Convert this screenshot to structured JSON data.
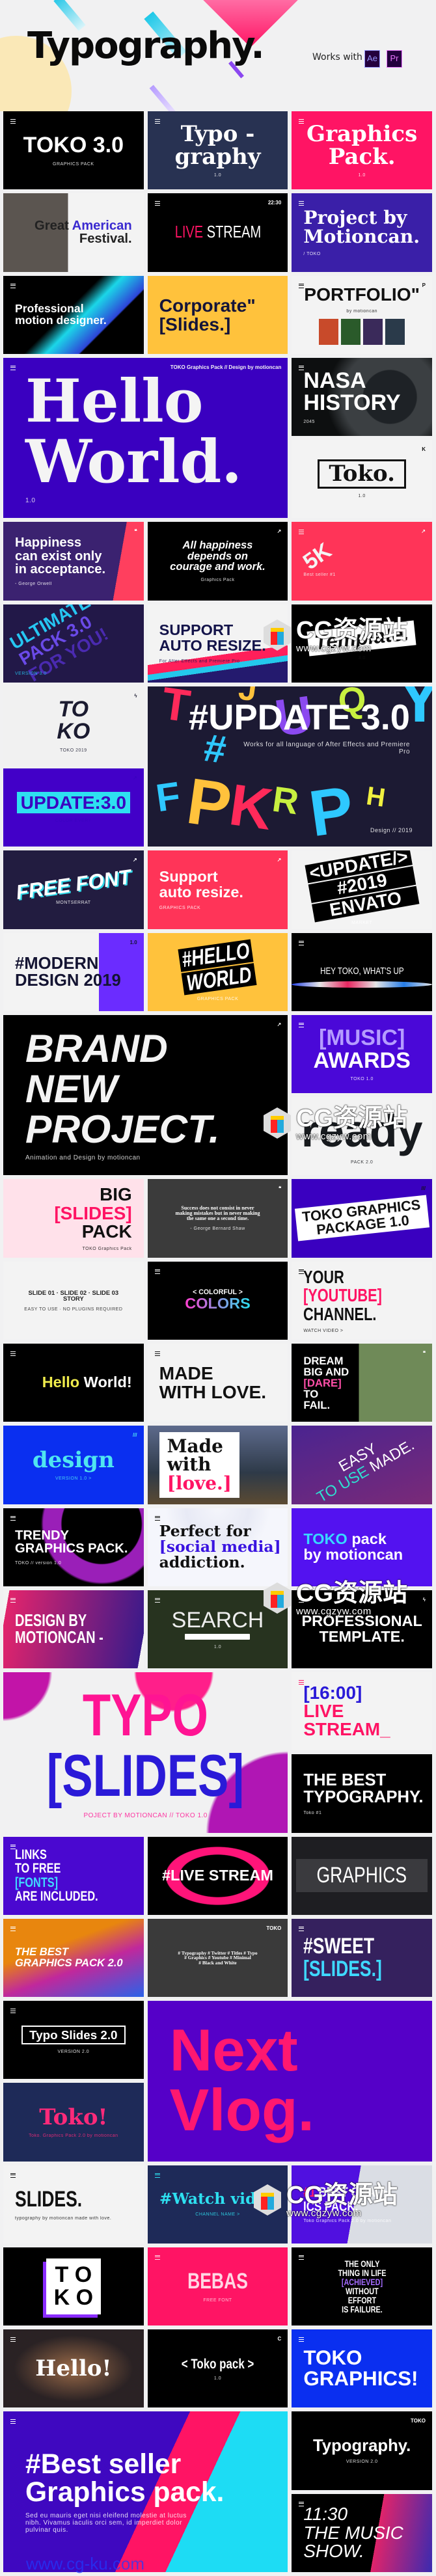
{
  "header": {
    "title": "Typography.",
    "works_with": "Works with",
    "badges": [
      {
        "label": "Ae",
        "color": "#9999ff"
      },
      {
        "label": "Pr",
        "color": "#ea77ff"
      }
    ]
  },
  "watermark": {
    "cn": "CG资源站",
    "url": "www.cgzyw.com",
    "alt_url": "www.cg-ku.com"
  },
  "colors": {
    "page_bg": "#f1f1f2",
    "pink": "#ff1464",
    "blue_violet": "#3a00c0",
    "cyan": "#25d8f0",
    "yellow": "#ffc23c"
  },
  "tiles": [
    {
      "n": "toko-3",
      "bg": "#000",
      "fg": "#fff",
      "a": "c",
      "lines": [
        "TOKO 3.0"
      ],
      "sub": "GRAPHICS PACK",
      "menu": true
    },
    {
      "n": "typography-1",
      "bg": "#283252",
      "fg": "#fff",
      "a": "c",
      "f": "slab",
      "lines": [
        "Typo -",
        "graphy"
      ],
      "sub": "1.0",
      "menu": true
    },
    {
      "n": "graphics-pack",
      "bg": "#ff1464",
      "fg": "#fff",
      "a": "c",
      "f": "slab",
      "lines": [
        "Graphics",
        "Pack."
      ],
      "sub": "1.0",
      "menu": true
    },
    {
      "n": "great-american-festival",
      "bg": "linear-gradient(90deg,#5b5550 0 46%,#f3f3f3 46%)",
      "fg": "#222",
      "a": "r",
      "lines": [
        "Great [American]",
        "Festival."
      ],
      "ac": "#3a2ad0",
      "menu": false
    },
    {
      "n": "live-stream-1",
      "bg": "#000",
      "fg": "#fff",
      "a": "c",
      "f": "cond light",
      "lines": [
        "[LIVE] STREAM"
      ],
      "ac": "#ff1464",
      "corner": "22:30",
      "menu": true
    },
    {
      "n": "project-by-motioncan",
      "bg": "#3a1fa8",
      "fg": "#fff",
      "a": "l",
      "f": "slab",
      "lines": [
        "Project by",
        "Motioncan."
      ],
      "sub": "/ TOKO",
      "menu": true,
      "deco": "blobs"
    },
    {
      "n": "professional-motion-designer",
      "bg": "linear-gradient(135deg,#000 45%,#1bd6e8 55%,#2d45d8 70%,#000 71%)",
      "fg": "#fff",
      "a": "l",
      "lines": [
        "Professional",
        "motion designer."
      ],
      "menu": true
    },
    {
      "n": "corporate-slides",
      "bg": "#ffc23c",
      "fg": "#14143a",
      "a": "l",
      "lines": [
        "Corporate\"",
        "[Slides.]"
      ],
      "ac": "#14143a",
      "menu": false
    },
    {
      "n": "portfolio",
      "bg": "#f3f3f3",
      "fg": "#111",
      "a": "c",
      "lines": [
        "PORTFOLIO\""
      ],
      "sub": "by motioncan",
      "corner": "P",
      "menu": true,
      "deco": "photos"
    },
    {
      "n": "hello-world-big",
      "bg": "#3a00c0",
      "fg": "#f4f4f4",
      "a": "l",
      "f": "slab",
      "big": true,
      "lines": [
        "Hello",
        "World."
      ],
      "sub": "1.0",
      "corner": "TOKO Graphics Pack // Design by motioncan",
      "menu": true
    },
    {
      "n": "nasa-history",
      "bg": "radial-gradient(circle at 70% 50%,#1e2226 0 25%,#3b3f42 26% 45%,#0d0f10 60%)",
      "fg": "#fff",
      "a": "l",
      "lines": [
        "NASA",
        "HISTORY"
      ],
      "sub": "2045",
      "menu": true
    },
    {
      "n": "toko-boxed",
      "bg": "#f3f3f3",
      "fg": "#111",
      "a": "c",
      "f": "slab",
      "lines": [
        "Toko."
      ],
      "sub": "1.0",
      "corner": "K",
      "boxed": true
    },
    {
      "n": "happiness-quote",
      "bg": "linear-gradient(100deg,#3b2270 80%,#ff3f5e 80%)",
      "fg": "#fff",
      "a": "l",
      "lines": [
        "Happiness",
        "can exist only",
        "in acceptance."
      ],
      "sub": "- George Orwell",
      "corner": "❝"
    },
    {
      "n": "all-happiness",
      "bg": "#000",
      "fg": "#fff",
      "a": "c",
      "f": "ital",
      "lines": [
        "All happiness",
        "depends on",
        "courage and work."
      ],
      "sub": "Graphics Pack",
      "corner": "↗"
    },
    {
      "n": "five-k",
      "bg": "#ff3458",
      "fg": "#f4f4f4",
      "a": "l",
      "lines": [
        "5K"
      ],
      "sub": "Best seller #1",
      "corner": "↗",
      "menu": true,
      "rot": -35
    },
    {
      "n": "ultimate-pack",
      "bg": "#221848",
      "fg": "#26c6f2",
      "a": "l",
      "lines": [
        "ULTIMATE",
        "PACK 3.0",
        "FOR YOU!"
      ],
      "sub": "VERSION 3.0",
      "rot": -30,
      "grad": true
    },
    {
      "n": "support-auto-resize-1",
      "bg": "linear-gradient(172deg,#f3f3f3 62%,#ff1f5a 62% 72%,#24c8ec 72% 78%,#241a6e 78%)",
      "fg": "#14144a",
      "a": "l",
      "lines": [
        "SUPPORT",
        "AUTO RESIZE."
      ],
      "sub": "For After Effects and Premiere Pro"
    },
    {
      "n": "template",
      "bg": "#000",
      "fg": "#111",
      "a": "c",
      "f": "ital",
      "lines": [
        "Template."
      ],
      "sub": "3.0",
      "boxed_light": true,
      "rot": -6
    },
    {
      "n": "toko-3d",
      "bg": "#f1f1f1",
      "fg": "#1b1b30",
      "a": "c",
      "f": "ital",
      "lines": [
        "TO",
        "KO"
      ],
      "sub": "TOKO 2019",
      "corner": "ϟ"
    },
    {
      "n": "update-3-letters",
      "bg": "#1c1a33",
      "fg": "#fff",
      "a": "r",
      "big": true,
      "lines": [
        "#UPDATE 3.0"
      ],
      "sub": "Works for all language of After Effects and Premiere Pro",
      "sub2": "Design // 2019",
      "deco": "letters"
    },
    {
      "n": "update-colon-3",
      "bg": "#4200c8",
      "fg": "#3a00c0",
      "a": "c",
      "lines": [
        "UPDATE:3.0"
      ],
      "sub": "COLOR EVERY",
      "hlbox": "#2ee0f0",
      "corner": "↗"
    },
    {
      "n": "free-font",
      "bg": "#221c40",
      "fg": "#fff",
      "a": "c",
      "f": "ital",
      "lines": [
        "FREE FONT"
      ],
      "sub": "MONTSERRAT",
      "corner": "↗",
      "rot": -8,
      "shadow": "#2ed8e8"
    },
    {
      "n": "support-auto-resize-2",
      "bg": "#ff3458",
      "fg": "#fff",
      "a": "l",
      "lines": [
        "Support",
        "auto resize."
      ],
      "sub": "GRAPHICS PACK",
      "corner": "↗"
    },
    {
      "n": "update-envato",
      "bg": "#f3f3f3",
      "fg": "#fff",
      "a": "c",
      "lines": [
        "<UPDATE/>",
        "#2019",
        "ENVATO"
      ],
      "sub": "MARKET",
      "blackbars": true,
      "rot": -10
    },
    {
      "n": "modern-design-2019",
      "bg": "linear-gradient(90deg,#f3f3f3 68%,#6b2cff 68%)",
      "fg": "#141432",
      "a": "l",
      "lines": [
        "#MODERN",
        "DESIGN 2019"
      ],
      "corner": "1.0"
    },
    {
      "n": "hello-world-hash",
      "bg": "#ffc23c",
      "fg": "#fff",
      "a": "c",
      "f": "cond ital",
      "lines": [
        "#HELLO",
        "WORLD"
      ],
      "sub": "GRAPHICS PACK",
      "blackbars": true,
      "rot": -8
    },
    {
      "n": "hey-toko",
      "bg": "#000",
      "fg": "#fff",
      "a": "c",
      "f": "cond light",
      "lines": [
        "HEY TOKO, WHAT'S UP"
      ],
      "menu": true,
      "deco": "wave"
    },
    {
      "n": "brand-new-project",
      "bg": "#000",
      "fg": "#f3f3f3",
      "a": "l",
      "f": "ital",
      "big": true,
      "lines": [
        "BRAND",
        "NEW",
        "PROJECT."
      ],
      "sub": "Animation and Design by motioncan",
      "corner": "↗"
    },
    {
      "n": "music-awards",
      "bg": "#4a08d8",
      "fg": "#fff",
      "a": "c",
      "lines": [
        "[MUSIC]",
        "AWARDS"
      ],
      "ac": "#b59cff",
      "sub": "TOKO 1.0",
      "menu": true
    },
    {
      "n": "pack-2",
      "bg": "#f3f3f3",
      "fg": "#171a1e",
      "a": "c",
      "lines": [
        "ready"
      ],
      "sub": "PACK 2.0",
      "huge": true
    },
    {
      "n": "big-slides-pack",
      "bg": "#ffe1ea",
      "fg": "#111",
      "a": "r",
      "lines": [
        "BIG",
        "[SLIDES]",
        "PACK"
      ],
      "ac": "#ff1464",
      "sub": "TOKO Graphics Pack"
    },
    {
      "n": "success-quote",
      "bg": "#3b3b3b",
      "fg": "#fff",
      "a": "c",
      "f": "serif",
      "lines": [
        "Success does not consist in never",
        "making mistakes but in never making",
        "the same one a second time."
      ],
      "sub": "- George Bernard Shaw",
      "corner": "❝"
    },
    {
      "n": "toko-graphics-package",
      "bg": "#3a00c0",
      "fg": "#111",
      "a": "c",
      "lines": [
        "TOKO GRAPHICS",
        "PACKAGE 1.0"
      ],
      "boxed_light": true,
      "rot": -6,
      "corner": "///"
    },
    {
      "n": "slide-stories",
      "bg": "#f3f3f3",
      "fg": "#222",
      "a": "c",
      "lines": [
        "SLIDE 01 · SLIDE 02 · SLIDE 03",
        "STORY"
      ],
      "sub": "EASY TO USE  ·  NO PLUGINS REQUIRED",
      "deco": "photogrid"
    },
    {
      "n": "colorful-colors",
      "bg": "#000",
      "fg": "#fff",
      "a": "c",
      "lines": [
        "< COLORFUL >",
        "COLORS"
      ],
      "grad2": true,
      "menu": true
    },
    {
      "n": "youtube-channel",
      "bg": "#f3f3f3",
      "fg": "#111",
      "a": "l",
      "f": "cond",
      "lines": [
        "YOUR",
        "[YOUTUBE]",
        "CHANNEL."
      ],
      "ac": "#ff1464",
      "sub": "WATCH VIDEO >",
      "menu": true
    },
    {
      "n": "hello-world-code",
      "bg": "#000",
      "fg": "#fff",
      "a": "r",
      "lines": [
        "[Hello] World!"
      ],
      "ac": "#f0ec4c",
      "menu": true,
      "deco": "code"
    },
    {
      "n": "made-with-love-1",
      "bg": "#f3f3f3",
      "fg": "#111",
      "a": "l",
      "lines": [
        "MADE",
        "WITH LOVE."
      ],
      "menu": true,
      "deco": "iso"
    },
    {
      "n": "dream-big",
      "bg": "linear-gradient(90deg,#000 48%,#6f8a58 48%)",
      "fg": "#fff",
      "a": "l",
      "lines": [
        "DREAM",
        "BIG AND",
        "[DARE]",
        "TO",
        "FAIL."
      ],
      "ac": "#ff4fa8",
      "corner": "❝"
    },
    {
      "n": "design",
      "bg": "#0a2ff0",
      "fg": "#4fe6f0",
      "a": "c",
      "f": "slab",
      "lines": [
        "design"
      ],
      "sub": "VERSION 1.0 >",
      "corner": "///"
    },
    {
      "n": "made-with-love-2",
      "bg": "linear-gradient(180deg,#5d6a8c,#2e3a48 60%,#5b4a32)",
      "fg": "#111",
      "a": "l",
      "f": "slab",
      "lines": [
        "Made",
        "with",
        "[love.]"
      ],
      "ac": "#ff1464",
      "card": true
    },
    {
      "n": "easy-to-use",
      "bg": "linear-gradient(160deg,#4a2490,#7a2a78)",
      "fg": "#fff",
      "a": "c",
      "f": "light",
      "lines": [
        "EASY",
        "[TO USE] MADE."
      ],
      "ac": "#2ee0d0",
      "rot": -30
    },
    {
      "n": "trendy-graphics-pack",
      "bg": "radial-gradient(circle at 70% 20%,#000 0 34%,#9a1fb8 35% 50%,#000 52%)",
      "fg": "#fff",
      "a": "l",
      "lines": [
        "TRENDY",
        "GRAPHICS PACK."
      ],
      "sub": "TOKO // version 1.0",
      "menu": true
    },
    {
      "n": "perfect-for-social-media",
      "bg": "radial-gradient(circle at 50% 0,#f4f5fb,#e8eaf5 30%,#f5f6fc 50%)",
      "fg": "#111",
      "a": "l",
      "f": "slab",
      "lines": [
        "Perfect for",
        "[social media]",
        "addiction."
      ],
      "ac": "#3a14e0",
      "menu": true
    },
    {
      "n": "toko-pack-by-motioncan",
      "bg": "#5312f0",
      "fg": "#fff",
      "a": "l",
      "lines": [
        "[TOKO] pack",
        "by motioncan"
      ],
      "ac": "#38d8ff"
    },
    {
      "n": "design-by-motioncan",
      "bg": "linear-gradient(100deg,#f3f3f3 4%,#e2246c 4%,#3a1a8a 96%,#f3f3f3 96%)",
      "fg": "#fff",
      "a": "l",
      "f": "cond",
      "lines": [
        "DESIGN BY",
        "MOTIONCAN -"
      ],
      "menu": true
    },
    {
      "n": "search",
      "bg": "#27331f",
      "fg": "#eee",
      "a": "c",
      "f": "light",
      "lines": [
        "SEARCH"
      ],
      "sub": "1.0",
      "search": true,
      "menu": true
    },
    {
      "n": "professional-template",
      "bg": "#000",
      "fg": "#fff",
      "a": "c",
      "lines": [
        "PROFESSIONAL",
        "TEMPLATE."
      ],
      "corner": "ϟ",
      "menu": true
    },
    {
      "n": "typo-slides",
      "bg": "radial-gradient(circle at 0 0,#c214a8 0 14%,transparent 15%),radial-gradient(circle at 100% 100%,#b016b4 0 24%,transparent 25%),radial-gradient(circle at 60% 0,#ff1f8a 0 16%,transparent 17%),#f1f1f2",
      "fg": "#ff1493",
      "a": "c",
      "f": "cond",
      "big": true,
      "lines": [
        "TYPO",
        "[SLIDES]"
      ],
      "ac": "#2a1ad8",
      "sub": "POJECT BY MOTIONCAN // TOKO 1.0"
    },
    {
      "n": "live-stream-2",
      "bg": "#f3f3f3",
      "fg": "#ff1464",
      "a": "l",
      "lines": [
        "[16:00]",
        "LIVE",
        "STREAM_"
      ],
      "ac": "#2a1ad8",
      "menu": true
    },
    {
      "n": "the-best-typography",
      "bg": "#000",
      "fg": "#fff",
      "a": "l",
      "lines": [
        "THE BEST",
        "TYPOGRAPHY."
      ],
      "sub": "Toko #1"
    },
    {
      "n": "links-to-free-fonts",
      "bg": "#4a08d0",
      "fg": "#fff",
      "a": "l",
      "f": "cond",
      "lines": [
        "LINKS",
        "TO FREE",
        "[FONTS]",
        "ARE INCLUDED."
      ],
      "ac": "#3fd9ff",
      "menu": true
    },
    {
      "n": "live-stream-hash",
      "bg": "radial-gradient(ellipse at 50% 50%,#000 0 38%,#ff1479 39% 52%,#000 53%)",
      "fg": "#fff",
      "a": "c",
      "lines": [
        "#LIVE STREAM"
      ]
    },
    {
      "n": "graphics",
      "bg": "#1e1e22",
      "fg": "#fff",
      "a": "c",
      "f": "cond light",
      "lines": [
        "GRAPHICS"
      ],
      "card": true
    },
    {
      "n": "best-graphics-pack-2",
      "bg": "linear-gradient(160deg,#e8860e 0 35%,#c0289c 60%,#2a62e8)",
      "fg": "#fff",
      "a": "l",
      "f": "ital",
      "lines": [
        "THE BEST",
        "GRAPHICS PACK 2.0"
      ],
      "menu": true
    },
    {
      "n": "hashtags",
      "bg": "#3a3a3a",
      "fg": "#fff",
      "a": "c",
      "f": "serif",
      "lines": [
        "# Typography # Twitter # Titles # Typo",
        "# Graphics # Youtube # Minimal",
        "# Black and White"
      ],
      "corner": "TOKO"
    },
    {
      "n": "sweet-slides",
      "bg": "#35215e",
      "fg": "#fff",
      "a": "l",
      "f": "cond",
      "lines": [
        "#SWEET",
        "[SLIDES.]"
      ],
      "ac": "#3fd9ff",
      "menu": true
    },
    {
      "n": "typo-slides-2",
      "bg": "#000",
      "fg": "#fff",
      "a": "c",
      "lines": [
        "Typo Slides 2.0"
      ],
      "sub": "VERSION 2.0",
      "outlined": true,
      "menu": true
    },
    {
      "n": "next-vlog",
      "bg": "#5500c8",
      "fg": "#ff1870",
      "a": "l",
      "big": true,
      "lines": [
        "Next",
        "Vlog."
      ]
    },
    {
      "n": "toko-excl",
      "bg": "#1e2a58",
      "fg": "#ff2a7a",
      "a": "c",
      "f": "slab",
      "lines": [
        "Toko!"
      ],
      "sub": "Toko. Graphics Pack 2.0 by motioncan"
    },
    {
      "n": "slides",
      "bg": "#f3f3f3",
      "fg": "#111",
      "a": "l",
      "f": "cond",
      "lines": [
        "SLIDES."
      ],
      "sub": "typography by motioncan made with love.",
      "menu": true
    },
    {
      "n": "watch-video",
      "bg": "#1e2a58",
      "fg": "#2ee0f0",
      "a": "c",
      "f": "slab",
      "lines": [
        "#Watch video"
      ],
      "sub": "CHANNEL NAME >",
      "menu": true
    },
    {
      "n": "number-one-best-graphics",
      "bg": "linear-gradient(100deg,#5010e0 45%,#dadde4 45%)",
      "fg": "#fff",
      "a": "l",
      "f": "cond",
      "lines": [
        "[#1] BEST GRAPH",
        "ICS PACK."
      ],
      "ac": "#ff1870",
      "sub": "Toko Graphics Pack 2.0 by motioncan"
    },
    {
      "n": "toko-square",
      "bg": "#000",
      "fg": "#000",
      "a": "c",
      "lines": [
        "T O",
        "K O"
      ],
      "square": true
    },
    {
      "n": "bebas",
      "bg": "#ff1464",
      "fg": "#ffd6e4",
      "a": "c",
      "f": "cond",
      "lines": [
        "BEBAS"
      ],
      "sub": "FREE FONT",
      "menu": true
    },
    {
      "n": "the-only-thing",
      "bg": "#000",
      "fg": "#fff",
      "a": "c",
      "f": "cond",
      "lines": [
        "THE ONLY",
        "THING IN LIFE",
        "[ACHIEVED]",
        "WITHOUT",
        "EFFORT",
        "IS FAILURE."
      ],
      "ac": "#a46cff",
      "menu": true
    },
    {
      "n": "hello-excl",
      "bg": "radial-gradient(ellipse at 50% 50%,#9a6a48,#2a2224 60%)",
      "fg": "#fff",
      "a": "c",
      "f": "slab",
      "lines": [
        "Hello!"
      ],
      "menu": true,
      "framed": true
    },
    {
      "n": "toko-pack-brackets",
      "bg": "#000",
      "fg": "#fff",
      "a": "c",
      "f": "cond",
      "lines": [
        "< Toko pack >"
      ],
      "sub": "1.0",
      "corner": "C"
    },
    {
      "n": "toko-graphics-excl",
      "bg": "#0a2ff0",
      "fg": "#fff",
      "a": "l",
      "lines": [
        "TOKO",
        "GRAPHICS!"
      ],
      "menu": true
    },
    {
      "n": "best-seller-graphics-pack",
      "bg": "linear-gradient(115deg,#3f08c0 52%,#ff1464 52% 66%,#1ddcf4 66%)",
      "fg": "#fff",
      "a": "l",
      "big": true,
      "lines": [
        "#Best seller",
        "Graphics pack."
      ],
      "sub": "Sed eu mauris eget nisi eleifend molestie at luctus nibh. Vivamus iaculis orci sem, id imperdiet dolor pulvinar quis.",
      "menu": true
    },
    {
      "n": "typography-toko",
      "bg": "#000",
      "fg": "#fff",
      "a": "c",
      "lines": [
        "Typography."
      ],
      "sub": "VERSION 2.0",
      "corner": "TOKO"
    },
    {
      "n": "music-show",
      "bg": "linear-gradient(100deg,#000 60%,#e0246a 60%,#3a2ab0)",
      "fg": "#fff",
      "a": "l",
      "f": "ital light",
      "lines": [
        "11:30",
        "THE MUSIC",
        "SHOW."
      ],
      "menu": true
    }
  ]
}
